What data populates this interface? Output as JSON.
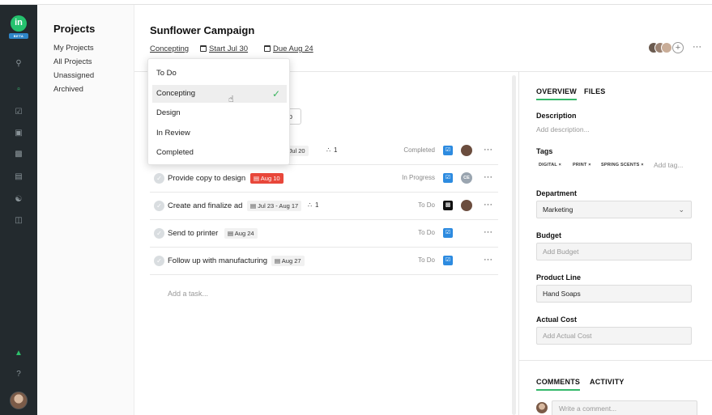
{
  "app": {
    "logo_text": "in",
    "beta_label": "BETA"
  },
  "rail": {
    "icons": [
      "search-icon",
      "folder-icon",
      "checkbox-icon",
      "inbox-icon",
      "search-doc-icon",
      "calendar-icon",
      "person-icon",
      "board-icon",
      "bell-icon",
      "help-icon"
    ],
    "help_glyph": "?"
  },
  "sidebar": {
    "title": "Projects",
    "items": [
      {
        "label": "My Projects"
      },
      {
        "label": "All Projects"
      },
      {
        "label": "Unassigned"
      },
      {
        "label": "Archived"
      }
    ]
  },
  "header": {
    "title": "Sunflower Campaign",
    "status_link": "Concepting",
    "start_link": "Start Jul 30",
    "due_link": "Due Aug 24",
    "plus_glyph": "+",
    "more_glyph": "···"
  },
  "status_dropdown": {
    "options": [
      {
        "label": "To Do",
        "selected": false
      },
      {
        "label": "Concepting",
        "selected": true
      },
      {
        "label": "Design",
        "selected": false
      },
      {
        "label": "In Review",
        "selected": false
      },
      {
        "label": "Completed",
        "selected": false
      }
    ],
    "tick_glyph": "✓"
  },
  "tasks": {
    "partial_button_label": "p",
    "rows": [
      {
        "name": "",
        "date": "- Jul 20",
        "attachments": "1",
        "status": "Completed",
        "type": "blue"
      },
      {
        "name": "Provide copy to design",
        "date": "Aug 10",
        "date_red": true,
        "status": "In Progress",
        "type": "blue",
        "assignee_initials": "CE"
      },
      {
        "name": "Create and finalize ad",
        "date": "Jul 23 - Aug 17",
        "attachments": "1",
        "status": "To Do",
        "type": "black"
      },
      {
        "name": "Send to printer",
        "date": "Aug 24",
        "status": "To Do",
        "type": "blue"
      },
      {
        "name": "Follow up with manufacturing",
        "date": "Aug 27",
        "status": "To Do",
        "type": "blue"
      }
    ],
    "add_placeholder": "Add a task..."
  },
  "details": {
    "tabs": [
      {
        "label": "OVERVIEW"
      },
      {
        "label": "FILES"
      }
    ],
    "description_label": "Description",
    "description_placeholder": "Add description...",
    "tags_label": "Tags",
    "tags": [
      "DIGITAL ×",
      "PRINT ×",
      "SPRING SCENTS ×"
    ],
    "add_tag_placeholder": "Add tag...",
    "department_label": "Department",
    "department_value": "Marketing",
    "budget_label": "Budget",
    "budget_placeholder": "Add Budget",
    "product_line_label": "Product Line",
    "product_line_value": "Hand Soaps",
    "actual_cost_label": "Actual Cost",
    "actual_cost_placeholder": "Add Actual Cost",
    "bottom_tabs": [
      {
        "label": "COMMENTS"
      },
      {
        "label": "ACTIVITY"
      }
    ],
    "comment_placeholder": "Write a comment..."
  },
  "colors": {
    "rail_bg": "#232a2e",
    "accent_green": "#35b86a",
    "task_type_blue": "#2d8be0",
    "overdue_red": "#e8473a"
  }
}
